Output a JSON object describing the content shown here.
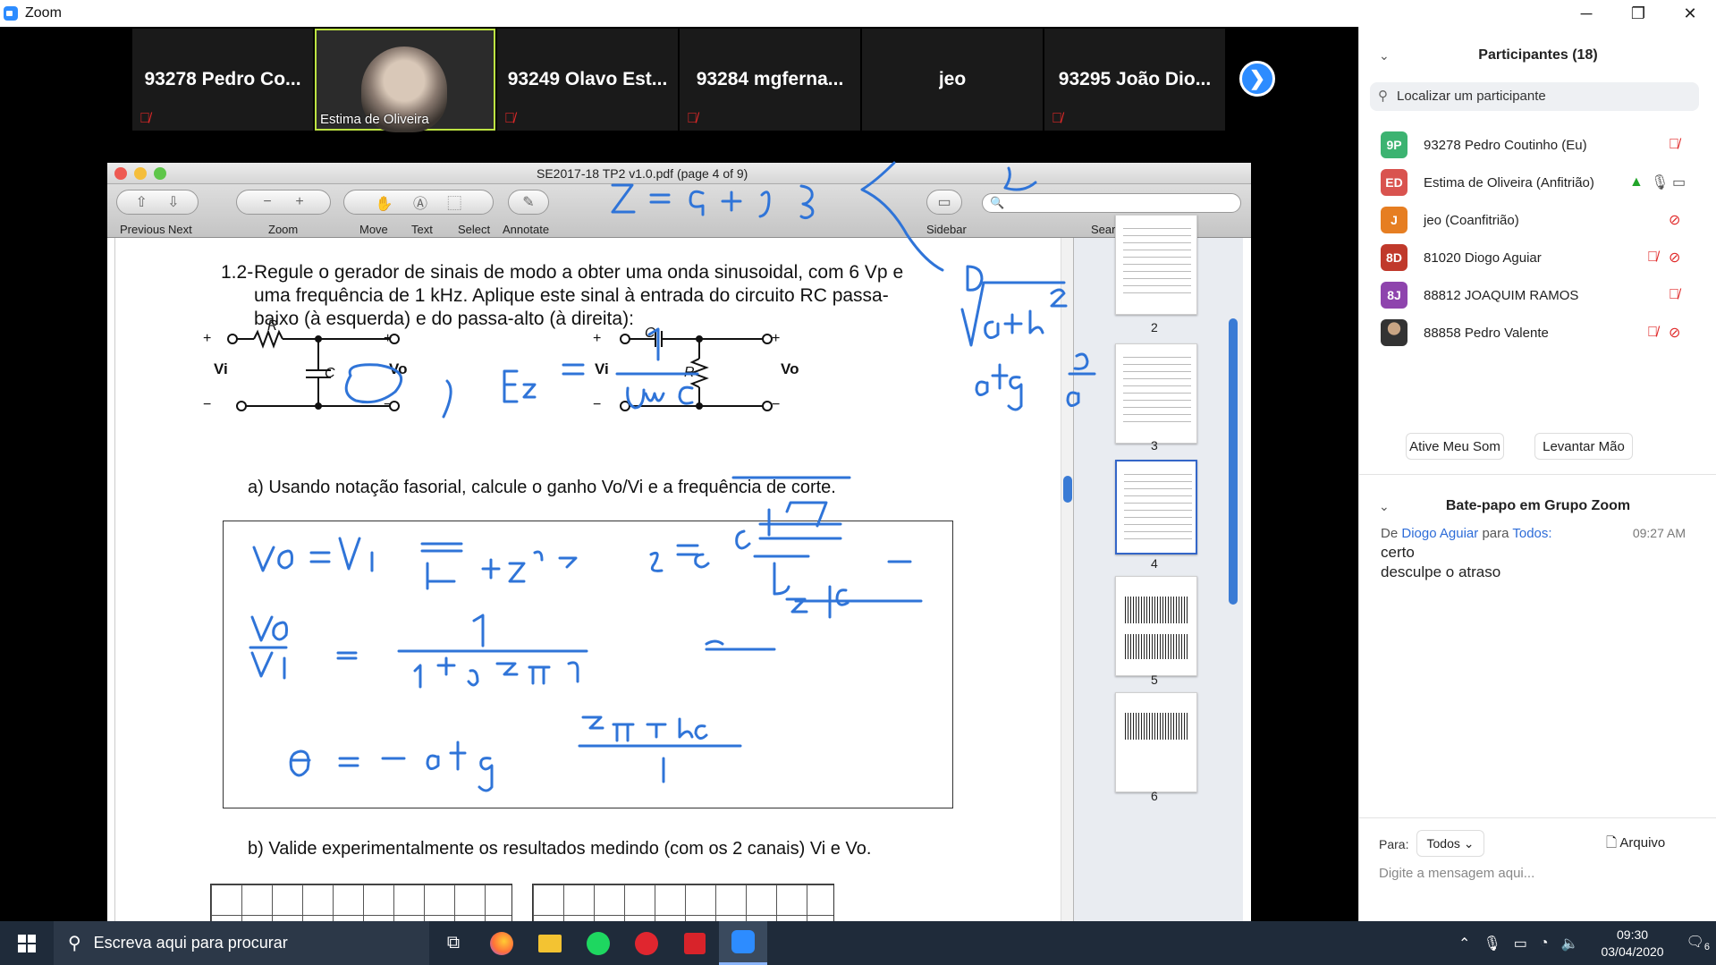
{
  "window": {
    "title": "Zoom",
    "minimize": "─",
    "restore": "❐",
    "close": "✕"
  },
  "gallery": {
    "tiles": [
      {
        "name": "93278 Pedro Co...",
        "muted": true
      },
      {
        "name": "Estima de Oliveira",
        "video": true
      },
      {
        "name": "93249 Olavo Est...",
        "muted": true
      },
      {
        "name": "93284 mgferna...",
        "muted": true
      },
      {
        "name": "jeo",
        "muted": false
      },
      {
        "name": "93295 João Dio...",
        "muted": true
      }
    ],
    "next_icon": "❯"
  },
  "preview": {
    "doc_title": "SE2017-18 TP2 v1.0.pdf (page 4 of 9)",
    "toolbar": {
      "previous": "Previous",
      "next": "Next",
      "zoom": "Zoom",
      "move": "Move",
      "text": "Text",
      "select": "Select",
      "annotate": "Annotate",
      "sidebar": "Sidebar",
      "search": "Search"
    },
    "content": {
      "q_num": "1.2-",
      "q_line1": "Regule o gerador de sinais de modo a obter uma onda sinusoidal, com 6 Vp e",
      "q_line2": "uma frequência de 1 kHz. Aplique este sinal à entrada do circuito RC passa-",
      "q_line3": "baixo (à esquerda) e do passa-alto (à direita):",
      "label_R": "R",
      "label_C": "C",
      "label_Vi": "Vi",
      "label_Vo": "Vo",
      "plus": "+",
      "minus": "−",
      "a_text": "a) Usando notação fasorial, calcule o ganho Vo/Vi e a frequência de corte.",
      "b_text": "b) Valide experimentalmente os resultados medindo (com os 2 canais) Vi e Vo."
    },
    "thumbnails": [
      {
        "num": "2"
      },
      {
        "num": "3"
      },
      {
        "num": "4",
        "selected": true
      },
      {
        "num": "5"
      },
      {
        "num": "6"
      }
    ]
  },
  "panel": {
    "participants_title": "Participantes (18)",
    "find_placeholder": "Localizar um participante",
    "participants": [
      {
        "initials": "9P",
        "color": "#3cb371",
        "name": "93278 Pedro Coutinho (Eu)",
        "mic": "muted"
      },
      {
        "initials": "ED",
        "color": "#d9534f",
        "name": "Estima de Oliveira (Anfitrião)",
        "mic": "on"
      },
      {
        "initials": "J",
        "color": "#e67e22",
        "name": "jeo (Coanfitrião)",
        "mic": "video-off"
      },
      {
        "initials": "8D",
        "color": "#c0392b",
        "name": "81020 Diogo Aguiar",
        "mic": "muted"
      },
      {
        "initials": "8J",
        "color": "#8e44ad",
        "name": "88812 JOAQUIM RAMOS",
        "mic": "muted"
      },
      {
        "initials": "",
        "color": "#444444",
        "name": "88858 Pedro Valente",
        "mic": "muted"
      }
    ],
    "unmute_button": "Ative Meu Som",
    "raise_hand_button": "Levantar Mão",
    "chat_title": "Bate-papo em Grupo Zoom",
    "chat": {
      "from_prefix": "De",
      "sender": "Diogo Aguiar",
      "to_word": "para",
      "recipient": "Todos:",
      "time": "09:27 AM",
      "messages": [
        "certo",
        "desculpe o atraso"
      ]
    },
    "to_label": "Para:",
    "to_value": "Todos",
    "file_button": "Arquivo",
    "message_placeholder": "Digite a mensagem aqui..."
  },
  "taskbar": {
    "search_placeholder": "Escreva aqui para procurar",
    "time": "09:30",
    "date": "03/04/2020",
    "notifications": "6"
  }
}
